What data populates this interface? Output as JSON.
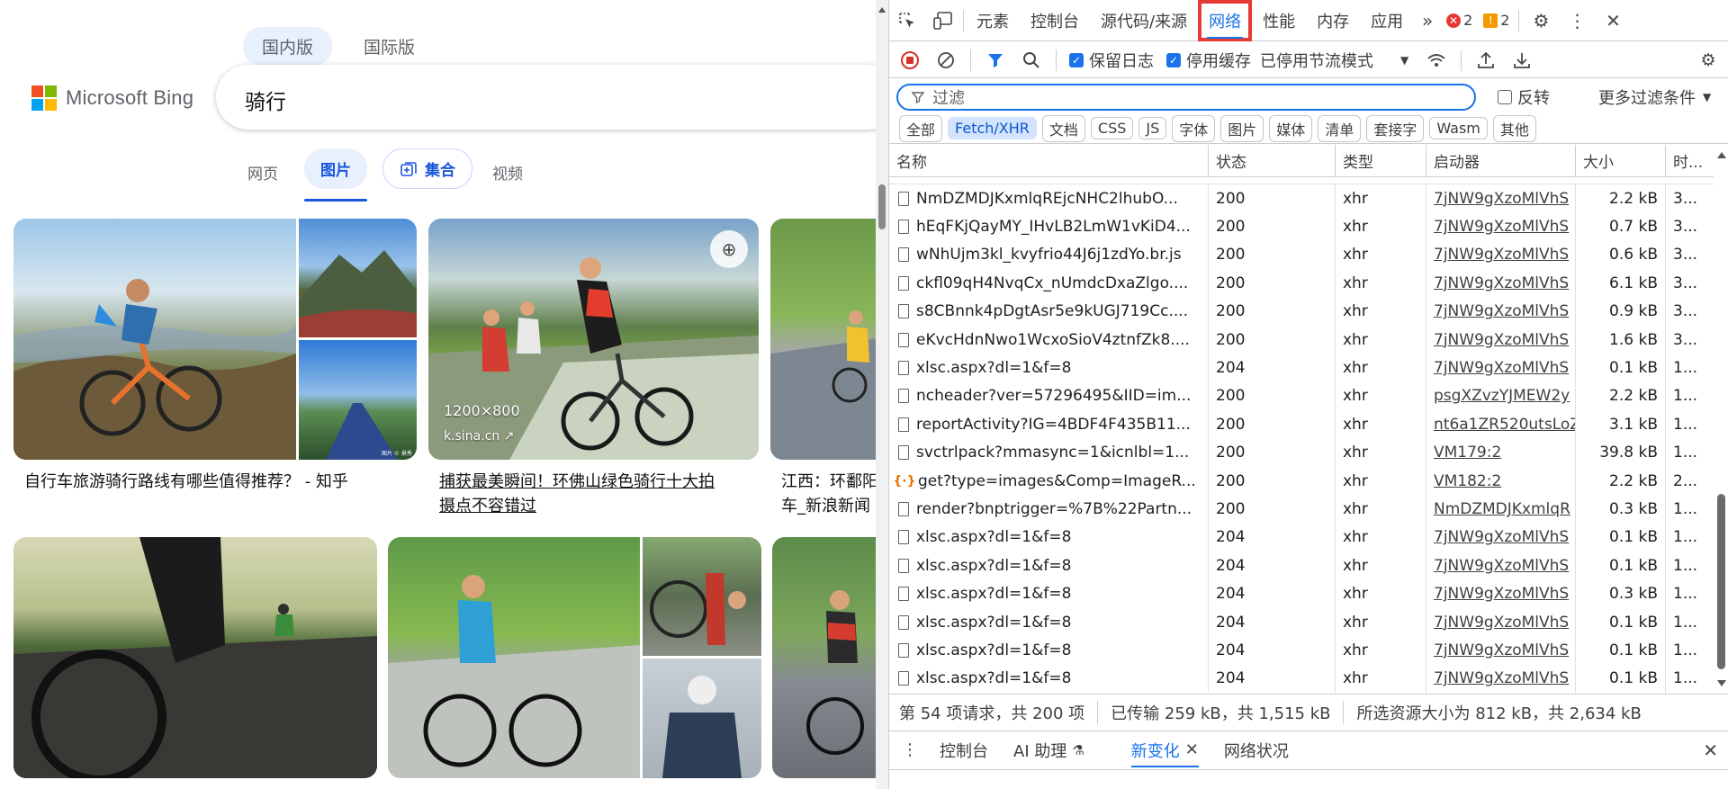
{
  "bing": {
    "logo_text": "Microsoft Bing",
    "logo_colors": [
      "#f25022",
      "#7fba00",
      "#00a4ef",
      "#ffb900"
    ],
    "market_tabs": [
      "国内版",
      "国际版"
    ],
    "query": "骑行",
    "vertical_tabs": {
      "web": "网页",
      "images": "图片",
      "collections": "集合",
      "videos": "视频"
    },
    "results": [
      {
        "caption": "自行车旅游骑行路线有哪些值得推荐？ - 知乎"
      },
      {
        "caption_line1": "捕获最美瞬间！环佛山绿色骑行十大拍",
        "caption_line2": "摄点不容错过",
        "size": "1200×800",
        "source": "k.sina.cn"
      },
      {
        "caption_line1": "江西：环鄱阳",
        "caption_line2": "车_新浪新闻"
      }
    ],
    "watermark": "图片 © 景秀"
  },
  "devtools": {
    "tabs": [
      "元素",
      "控制台",
      "源代码/来源",
      "网络",
      "性能",
      "内存",
      "应用"
    ],
    "selected_tab": "网络",
    "error_count": "2",
    "warning_count": "2",
    "toolbar": {
      "preserve_log": "保留日志",
      "disable_cache": "停用缓存",
      "throttle": "已停用节流模式"
    },
    "filter": {
      "placeholder": "过滤",
      "invert": "反转",
      "more": "更多过滤条件"
    },
    "type_filters": [
      "全部",
      "Fetch/XHR",
      "文档",
      "CSS",
      "JS",
      "字体",
      "图片",
      "媒体",
      "清单",
      "套接字",
      "Wasm",
      "其他"
    ],
    "active_type_filter": "Fetch/XHR",
    "columns": {
      "name": "名称",
      "status": "状态",
      "type": "类型",
      "initiator": "启动器",
      "size": "大小",
      "time": "时..."
    },
    "rows": [
      {
        "name": "NmDZMDJKxmlqREjcNHC2lhubO...",
        "status": "200",
        "type": "xhr",
        "initiator": "7jNW9gXzoMlVhS",
        "size": "2.2 kB",
        "time": "3...",
        "icon": "file"
      },
      {
        "name": "hEqFKjQayMY_IHvLB2LmW1vKiD4...",
        "status": "200",
        "type": "xhr",
        "initiator": "7jNW9gXzoMlVhS",
        "size": "0.7 kB",
        "time": "3...",
        "icon": "file"
      },
      {
        "name": "wNhUjm3kl_kvyfrio44J6j1zdYo.br.js",
        "status": "200",
        "type": "xhr",
        "initiator": "7jNW9gXzoMlVhS",
        "size": "0.6 kB",
        "time": "3...",
        "icon": "file"
      },
      {
        "name": "ckfl09qH4NvqCx_nUmdcDxaZlgo....",
        "status": "200",
        "type": "xhr",
        "initiator": "7jNW9gXzoMlVhS",
        "size": "6.1 kB",
        "time": "3...",
        "icon": "file"
      },
      {
        "name": "s8CBnnk4pDgtAsr5e9kUGJ719Cc....",
        "status": "200",
        "type": "xhr",
        "initiator": "7jNW9gXzoMlVhS",
        "size": "0.9 kB",
        "time": "3...",
        "icon": "file"
      },
      {
        "name": "eKvcHdnNwo1WcxoSioV4ztnfZk8....",
        "status": "200",
        "type": "xhr",
        "initiator": "7jNW9gXzoMlVhS",
        "size": "1.6 kB",
        "time": "3...",
        "icon": "file"
      },
      {
        "name": "xlsc.aspx?dl=1&f=8",
        "status": "204",
        "type": "xhr",
        "initiator": "7jNW9gXzoMlVhS",
        "size": "0.1 kB",
        "time": "1...",
        "icon": "file"
      },
      {
        "name": "ncheader?ver=57296495&IID=im...",
        "status": "200",
        "type": "xhr",
        "initiator": "psgXZvzYJMEW2y",
        "size": "2.2 kB",
        "time": "1...",
        "icon": "file"
      },
      {
        "name": "reportActivity?IG=4BDF4F435B11...",
        "status": "200",
        "type": "xhr",
        "initiator": "nt6a1ZR520utsLoZ",
        "size": "3.1 kB",
        "time": "1...",
        "icon": "file"
      },
      {
        "name": "svctrlpack?mmasync=1&icnlbl=1...",
        "status": "200",
        "type": "xhr",
        "initiator": "VM179:2",
        "size": "39.8 kB",
        "time": "1...",
        "icon": "file"
      },
      {
        "name": "get?type=images&Comp=ImageR...",
        "status": "200",
        "type": "xhr",
        "initiator": "VM182:2",
        "size": "2.2 kB",
        "time": "2...",
        "icon": "fetch"
      },
      {
        "name": "render?bnptrigger=%7B%22Partn...",
        "status": "200",
        "type": "xhr",
        "initiator": "NmDZMDJKxmlqR",
        "size": "0.3 kB",
        "time": "1...",
        "icon": "file"
      },
      {
        "name": "xlsc.aspx?dl=1&f=8",
        "status": "204",
        "type": "xhr",
        "initiator": "7jNW9gXzoMlVhS",
        "size": "0.1 kB",
        "time": "1...",
        "icon": "file"
      },
      {
        "name": "xlsc.aspx?dl=1&f=8",
        "status": "204",
        "type": "xhr",
        "initiator": "7jNW9gXzoMlVhS",
        "size": "0.1 kB",
        "time": "1...",
        "icon": "file"
      },
      {
        "name": "xlsc.aspx?dl=1&f=8",
        "status": "204",
        "type": "xhr",
        "initiator": "7jNW9gXzoMlVhS",
        "size": "0.3 kB",
        "time": "1...",
        "icon": "file"
      },
      {
        "name": "xlsc.aspx?dl=1&f=8",
        "status": "204",
        "type": "xhr",
        "initiator": "7jNW9gXzoMlVhS",
        "size": "0.1 kB",
        "time": "1...",
        "icon": "file"
      },
      {
        "name": "xlsc.aspx?dl=1&f=8",
        "status": "204",
        "type": "xhr",
        "initiator": "7jNW9gXzoMlVhS",
        "size": "0.1 kB",
        "time": "1...",
        "icon": "file"
      },
      {
        "name": "xlsc.aspx?dl=1&f=8",
        "status": "204",
        "type": "xhr",
        "initiator": "7jNW9gXzoMlVhS",
        "size": "0.1 kB",
        "time": "1...",
        "icon": "file"
      }
    ],
    "status_bar": {
      "requests": "第 54 项请求，共 200 项",
      "transferred": "已传输 259 kB，共 1,515 kB",
      "resources": "所选资源大小为 812 kB，共 2,634 kB"
    },
    "drawer_tabs": [
      "控制台",
      "AI 助理",
      "新变化",
      "网络状况"
    ],
    "drawer_selected": "新变化",
    "colors": {
      "accent": "#1a73e8",
      "highlight_box": "#e53935"
    }
  }
}
